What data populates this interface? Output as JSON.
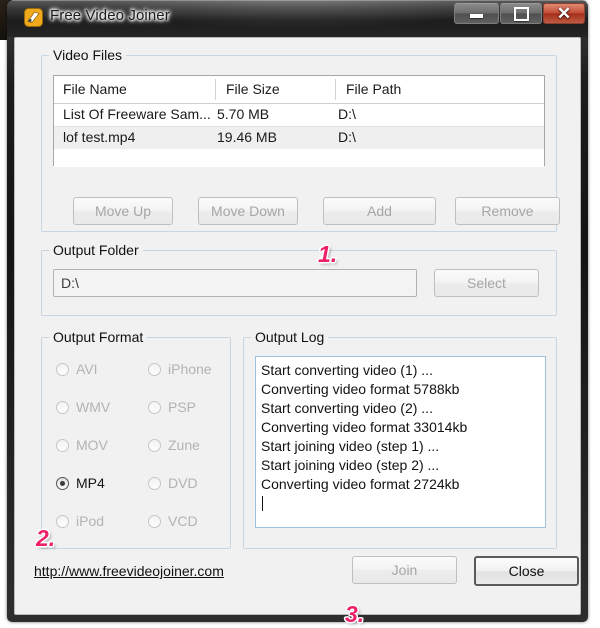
{
  "window": {
    "title": "Free Video Joiner",
    "icon": "app-film-icon",
    "controls": {
      "minimize": "minimize-icon",
      "maximize": "maximize-icon",
      "close": "close-icon",
      "close_glyph": "✕"
    }
  },
  "video_files": {
    "group_title": "Video Files",
    "columns": [
      "File Name",
      "File Size",
      "File Path"
    ],
    "rows": [
      {
        "name": "List Of Freeware Sam...",
        "size": "5.70 MB",
        "path": "D:\\"
      },
      {
        "name": "lof test.mp4",
        "size": "19.46 MB",
        "path": "D:\\"
      }
    ],
    "buttons": {
      "move_up": "Move Up",
      "move_down": "Move Down",
      "add": "Add",
      "remove": "Remove"
    }
  },
  "output_folder": {
    "group_title": "Output Folder",
    "path_value": "D:\\",
    "path_placeholder": "D:\\",
    "select_label": "Select"
  },
  "output_format": {
    "group_title": "Output Format",
    "selected": "MP4",
    "options_left": [
      "AVI",
      "WMV",
      "MOV",
      "MP4",
      "iPod"
    ],
    "options_right": [
      "iPhone",
      "PSP",
      "Zune",
      "DVD",
      "VCD"
    ]
  },
  "output_log": {
    "group_title": "Output Log",
    "lines": [
      "Start converting video (1) ...",
      "Converting video format 5788kb",
      "Start converting video (2) ...",
      "Converting video format 33014kb",
      "Start joining video (step 1) ...",
      "Start joining video (step 2) ...",
      "Converting video format 2724kb"
    ]
  },
  "footer": {
    "website": "http://www.freevideojoiner.com",
    "join_label": "Join",
    "close_label": "Close"
  },
  "annotations": {
    "step1": "1.",
    "step2": "2.",
    "step3": "3.",
    "color": "#ee1f6a"
  }
}
